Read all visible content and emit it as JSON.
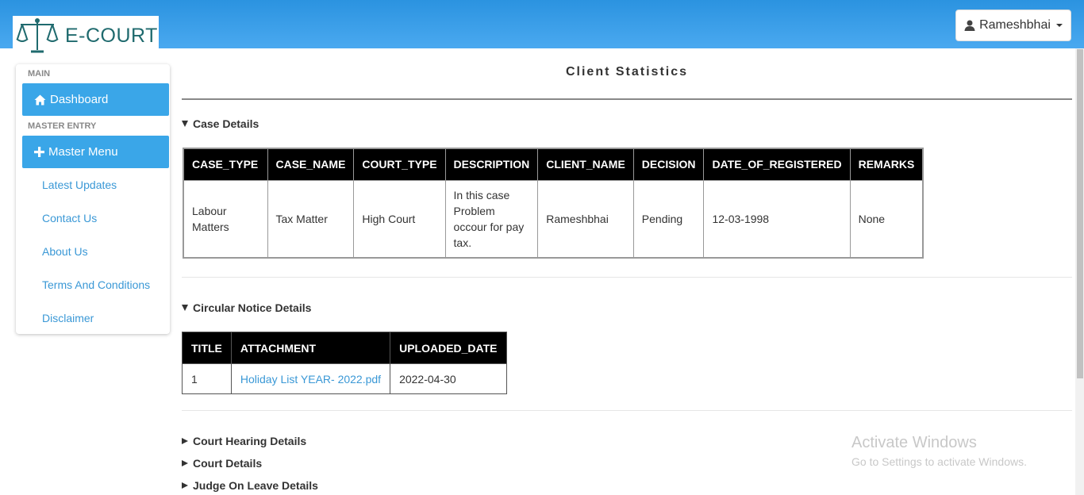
{
  "header": {
    "brand": "E-COURT",
    "user": "Rameshbhai"
  },
  "sidebar": {
    "section_main": "MAIN",
    "dashboard": "Dashboard",
    "section_master": "MASTER ENTRY",
    "master_menu": "Master Menu",
    "links": [
      "Latest Updates",
      "Contact Us",
      "About Us",
      "Terms And Conditions",
      "Disclaimer"
    ]
  },
  "main": {
    "title": "Client Statistics",
    "case_section": "Case Details",
    "case_table": {
      "headers": [
        "CASE_TYPE",
        "CASE_NAME",
        "COURT_TYPE",
        "DESCRIPTION",
        "CLIENT_NAME",
        "DECISION",
        "DATE_OF_REGISTERED",
        "REMARKS"
      ],
      "row": [
        "Labour Matters",
        "Tax Matter",
        "High Court",
        "In this case Problem occour for pay tax.",
        "Rameshbhai",
        "Pending",
        "12-03-1998",
        "None"
      ]
    },
    "notice_section": "Circular Notice Details",
    "notice_table": {
      "headers": [
        "TITLE",
        "ATTACHMENT",
        "UPLOADED_DATE"
      ],
      "row": [
        "1",
        "Holiday List YEAR- 2022.pdf",
        "2022-04-30"
      ]
    },
    "collapsed_sections": [
      "Court Hearing Details",
      "Court Details",
      "Judge On Leave Details"
    ]
  },
  "watermark": {
    "title": "Activate Windows",
    "subtitle": "Go to Settings to activate Windows."
  },
  "colors": {
    "header": "#3aa0ea",
    "sidebar_button": "#3aa6e8",
    "link": "#3a98d6",
    "table_header": "#000000"
  }
}
